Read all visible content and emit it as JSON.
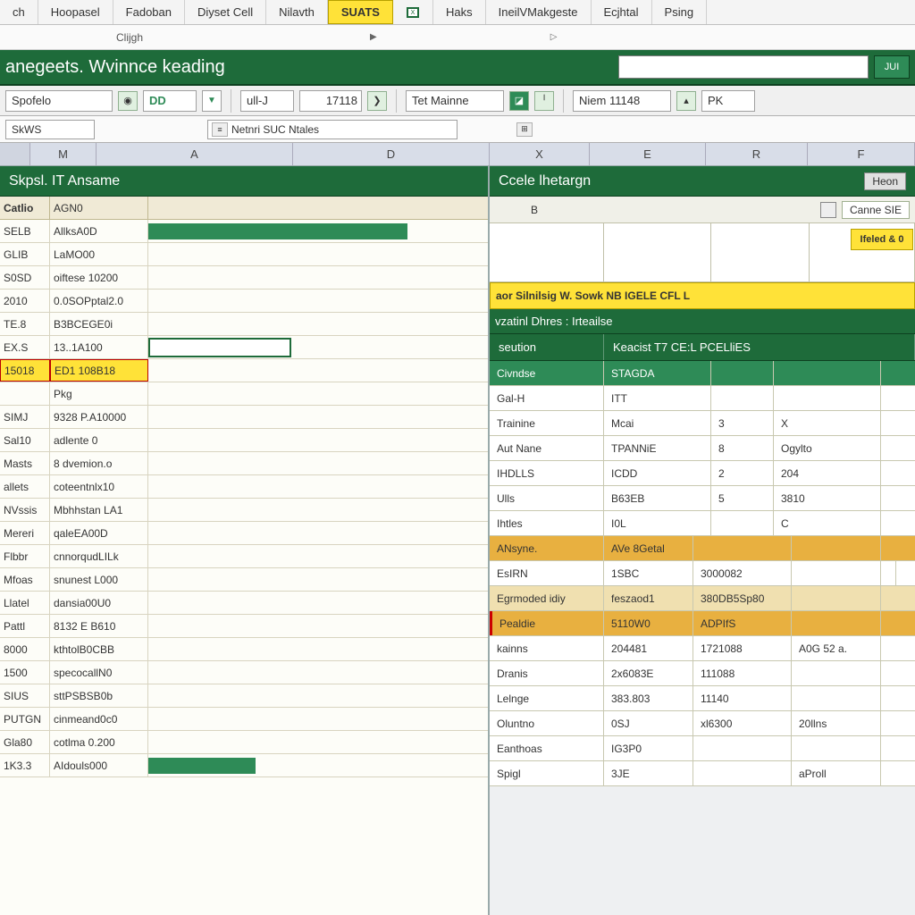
{
  "menubar": {
    "items": [
      "ch",
      "Hoopasel",
      "Fadoban",
      "Diyset Cell",
      "Nilavth",
      "SUATS",
      "",
      "Haks",
      "IneilVMakgeste",
      "Ecjhtal",
      "Psing"
    ],
    "active_index": 5
  },
  "toolrow1": {
    "label": "Clijgh",
    "arrow1": "▶",
    "arrow2": "▷"
  },
  "ribbon": {
    "title": "anegeets. Wvinnce keading",
    "btn": "JUI"
  },
  "propbar": {
    "f1": "Spofelo",
    "dd": "DD",
    "f2": "ull-J",
    "num": "17118",
    "f3": "Tet Mainne",
    "f4": "Niem 11148",
    "last": "PK"
  },
  "fxbar": {
    "namebox": "SkWS",
    "input": "Netnri   SUC  Ntales"
  },
  "cols": {
    "left": [
      "M",
      "A",
      "D"
    ],
    "right": [
      "X",
      "E",
      "R",
      "F"
    ]
  },
  "leftpanel": {
    "title": "Skpsl. IT Ansame",
    "subhdr": {
      "c1": "Catlio",
      "c2": "AGN0"
    },
    "rows": [
      {
        "c1": "SELB",
        "c2": "AllksA0D",
        "bar": true
      },
      {
        "c1": "GLIB",
        "c2": "LaMO00"
      },
      {
        "c1": "S0SD",
        "c2": "oiftese 10200"
      },
      {
        "c1": "2010",
        "c2": "0.0SOPptal2.0"
      },
      {
        "c1": "TE.8",
        "c2": "B3BCEGE0i"
      },
      {
        "c1": "EX.S",
        "c2": "13..1A100",
        "edit": true
      },
      {
        "c1": "15018",
        "c2": "ED1 108B18",
        "hl": true
      },
      {
        "c1": "",
        "c2": "Pkg"
      },
      {
        "c1": "SIMJ",
        "c2": "9328 P.A10000"
      },
      {
        "c1": "Sal10",
        "c2": "adlente 0"
      },
      {
        "c1": "Masts",
        "c2": "8 dvemion.o"
      },
      {
        "c1": "allets",
        "c2": "coteentnlx10"
      },
      {
        "c1": "NVssis",
        "c2": "Mbhhstan LA1"
      },
      {
        "c1": "Mereri",
        "c2": "qaleEA00D"
      },
      {
        "c1": "Flbbr",
        "c2": "cnnorqudLILk"
      },
      {
        "c1": "Mfoas",
        "c2": "snunest L000"
      },
      {
        "c1": "Llatel",
        "c2": "dansia00U0"
      },
      {
        "c1": "Pattl",
        "c2": "8132 E B610"
      },
      {
        "c1": "8000",
        "c2": "kthtolB0CBB"
      },
      {
        "c1": "1500",
        "c2": "specocallN0"
      },
      {
        "c1": "SIUS",
        "c2": "sttPSBSB0b"
      },
      {
        "c1": "PUTGN",
        "c2": "cinmeand0c0"
      },
      {
        "c1": "Gla80",
        "c2": "cotlma 0.200"
      },
      {
        "c1": "1K3.3",
        "c2": "AIdouls000",
        "greenfill": true
      }
    ]
  },
  "rightpanel": {
    "title": "Ccele lhetargn",
    "hbtn": "Heon",
    "toolbar": {
      "tbtn": "Canne SIE"
    },
    "blank_b": "B",
    "sidebtn": "Ifeled & 0",
    "yellow": "aor Silnilsig W. Sowk NB IGELE CFL L",
    "greenband": "vzatinl Dhres : Irteailse",
    "greenband2": [
      "seution",
      "Keacist T7 CE:L PCELliES"
    ],
    "rows1": [
      {
        "c": [
          "Civndse",
          "STAGDA",
          "",
          ""
        ],
        "green": true
      },
      {
        "c": [
          "Gal-H",
          "ITT",
          "",
          ""
        ]
      },
      {
        "c": [
          "Trainine",
          "Mcai",
          "3",
          "X"
        ]
      },
      {
        "c": [
          "Aut Nane",
          "TPANNiE",
          "8",
          "Ogylto"
        ]
      },
      {
        "c": [
          "IHDLLS",
          "ICDD",
          "2",
          "204"
        ]
      },
      {
        "c": [
          "Ulls",
          "B63EB",
          "5",
          "3810"
        ]
      },
      {
        "c": [
          "Ihtles",
          "I0L",
          "",
          "C"
        ]
      }
    ],
    "rows2": [
      {
        "c": [
          "ANsyne.",
          "AVe 8Getal",
          "",
          ""
        ],
        "cls": "hl-gold"
      },
      {
        "c": [
          "EsIRN",
          "1SBC",
          "3000082",
          "",
          ""
        ]
      },
      {
        "c": [
          "Egrmoded idiy",
          "feszaod1",
          "380DB5Sp80",
          ""
        ],
        "cls": "hl-tan"
      },
      {
        "c": [
          "Pealdie",
          "5110W0",
          "ADPIfS",
          ""
        ],
        "cls": "hl-gold redbar"
      },
      {
        "c": [
          "kainns",
          "204481",
          "1721088",
          "A0G 52 a."
        ]
      },
      {
        "c": [
          "Dranis",
          "2x6083E",
          "111088",
          ""
        ]
      },
      {
        "c": [
          "Lelnge",
          "383.803",
          "11140",
          ""
        ]
      },
      {
        "c": [
          "Oluntno",
          "0SJ",
          "xl6300",
          "20llns"
        ]
      },
      {
        "c": [
          "Eanthoas",
          "IG3P0",
          "",
          ""
        ]
      },
      {
        "c": [
          "Spigl",
          "3JE",
          "",
          "aProll"
        ]
      }
    ]
  }
}
